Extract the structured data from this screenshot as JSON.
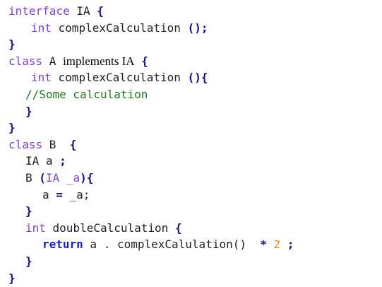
{
  "code": {
    "l1": {
      "kw": "interface",
      "name": " IA ",
      "brace": "{"
    },
    "l2": {
      "kw": "int",
      "name": " complexCalculation ",
      "punct": "();"
    },
    "l3": {
      "brace": "}"
    },
    "l4": {
      "kw": "class",
      "name": " A ",
      "impl": "implements IA",
      "brace": " {"
    },
    "l5": {
      "kw": "int",
      "name": " complexCalculation ",
      "punct": "(){"
    },
    "l6": {
      "comment": "//Some calculation"
    },
    "l7": {
      "brace": "}"
    },
    "l8": {
      "brace": "}"
    },
    "l9": {
      "kw": "class",
      "name": " B  ",
      "brace": "{"
    },
    "l10": {
      "text": "IA a ",
      "punct": ";"
    },
    "l11": {
      "name": "B ",
      "p1": "(",
      "type": "IA _a",
      "p2": "){"
    },
    "l12": {
      "text": "a ",
      "op": "=",
      "rest": " _a;"
    },
    "l13": {
      "brace": "}"
    },
    "l14": {
      "kw": "int",
      "name": " doubleCalculation ",
      "brace": "{"
    },
    "l15": {
      "kw": "return",
      "name": " a . complexCalulation()  ",
      "op": "*",
      "num": " 2",
      "punct": " ;"
    },
    "l16": {
      "brace": "}"
    },
    "l17": {
      "brace": "}"
    }
  },
  "colors": {
    "keyword": "#7b3fd6",
    "return_keyword": "#1a1ad6",
    "brace": "#10108a",
    "comment": "#1a7a1a",
    "number": "#e88a12"
  }
}
